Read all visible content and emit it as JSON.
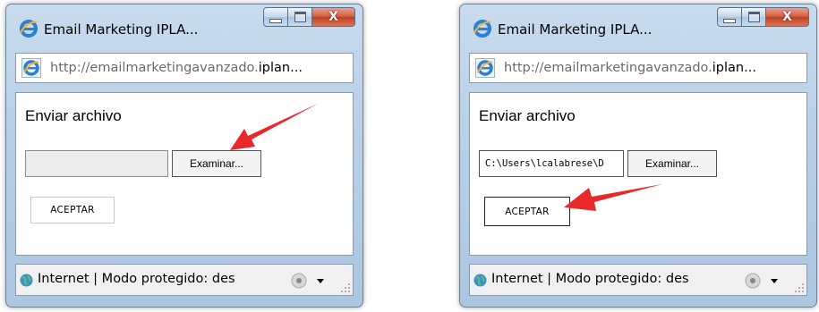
{
  "windows": [
    {
      "title": "Email Marketing IPLA...",
      "address": {
        "prefix": "http://emailmarketingavanzado.",
        "host": "iplan..."
      },
      "heading": "Enviar archivo",
      "file_value": "",
      "browse_label": "Examinar...",
      "accept_label": "ACEPTAR",
      "status": "Internet | Modo protegido: des"
    },
    {
      "title": "Email Marketing IPLA...",
      "address": {
        "prefix": "http://emailmarketingavanzado.",
        "host": "iplan..."
      },
      "heading": "Enviar archivo",
      "file_value": "C:\\Users\\lcalabrese\\D",
      "browse_label": "Examinar...",
      "accept_label": "ACEPTAR",
      "status": "Internet | Modo protegido: des"
    }
  ],
  "close_glyph": "X",
  "colors": {
    "annotation_arrow": "#e8282b",
    "titlebar": "#b9d0e7",
    "close_button": "#c2401f"
  },
  "icons": [
    "ie-logo-icon",
    "minimize-icon",
    "maximize-icon",
    "close-icon",
    "globe-icon",
    "zoom-icon",
    "resize-grip-icon",
    "annotation-arrow-icon"
  ]
}
